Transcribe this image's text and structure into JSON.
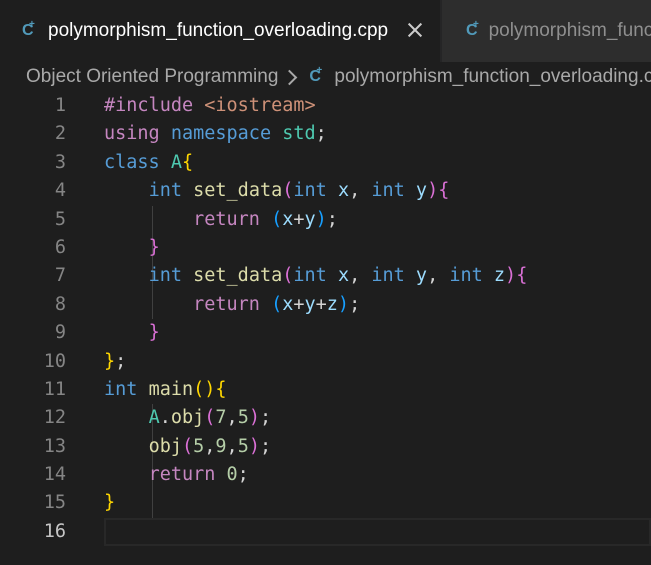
{
  "tabs": [
    {
      "label": "polymorphism_function_overloading.cpp",
      "icon": "cpp-file-icon",
      "active": true,
      "closable": true
    },
    {
      "label": "polymorphism_function_overloading.cpp",
      "icon": "cpp-file-icon",
      "active": false
    }
  ],
  "breadcrumb": {
    "folder": "Object Oriented Programming",
    "file": "polymorphism_function_overloading.cpp"
  },
  "editor": {
    "current_line": 16,
    "colors": {
      "background": "#1e1e1e",
      "keyword": "#c586c0",
      "type": "#569cd6",
      "function": "#dcdcaa",
      "variable": "#9cdcfe",
      "number": "#b5cea8",
      "string": "#ce9178",
      "class": "#4ec9b0"
    },
    "lines": [
      {
        "number": "1",
        "tokens": [
          {
            "t": "#include",
            "c": "kw"
          },
          {
            "t": " ",
            "c": "plain"
          },
          {
            "t": "<iostream>",
            "c": "str"
          }
        ]
      },
      {
        "number": "2",
        "tokens": [
          {
            "t": "using",
            "c": "kw"
          },
          {
            "t": " ",
            "c": "plain"
          },
          {
            "t": "namespace",
            "c": "type"
          },
          {
            "t": " ",
            "c": "plain"
          },
          {
            "t": "std",
            "c": "ns"
          },
          {
            "t": ";",
            "c": "plain"
          }
        ]
      },
      {
        "number": "3",
        "tokens": [
          {
            "t": "class",
            "c": "type"
          },
          {
            "t": " ",
            "c": "plain"
          },
          {
            "t": "A",
            "c": "cls"
          },
          {
            "t": "{",
            "c": "p1"
          }
        ]
      },
      {
        "number": "4",
        "tokens": [
          {
            "t": "    ",
            "c": "plain"
          },
          {
            "t": "int",
            "c": "type"
          },
          {
            "t": " ",
            "c": "plain"
          },
          {
            "t": "set_data",
            "c": "fn"
          },
          {
            "t": "(",
            "c": "p2"
          },
          {
            "t": "int",
            "c": "type"
          },
          {
            "t": " ",
            "c": "plain"
          },
          {
            "t": "x",
            "c": "var"
          },
          {
            "t": ", ",
            "c": "plain"
          },
          {
            "t": "int",
            "c": "type"
          },
          {
            "t": " ",
            "c": "plain"
          },
          {
            "t": "y",
            "c": "var"
          },
          {
            "t": ")",
            "c": "p2"
          },
          {
            "t": "{",
            "c": "p2"
          }
        ]
      },
      {
        "number": "5",
        "tokens": [
          {
            "t": "        ",
            "c": "plain"
          },
          {
            "t": "return",
            "c": "kw"
          },
          {
            "t": " ",
            "c": "plain"
          },
          {
            "t": "(",
            "c": "p3"
          },
          {
            "t": "x",
            "c": "var"
          },
          {
            "t": "+",
            "c": "plain"
          },
          {
            "t": "y",
            "c": "var"
          },
          {
            "t": ")",
            "c": "p3"
          },
          {
            "t": ";",
            "c": "plain"
          }
        ]
      },
      {
        "number": "6",
        "tokens": [
          {
            "t": "    ",
            "c": "plain"
          },
          {
            "t": "}",
            "c": "p2"
          }
        ]
      },
      {
        "number": "7",
        "tokens": [
          {
            "t": "    ",
            "c": "plain"
          },
          {
            "t": "int",
            "c": "type"
          },
          {
            "t": " ",
            "c": "plain"
          },
          {
            "t": "set_data",
            "c": "fn"
          },
          {
            "t": "(",
            "c": "p2"
          },
          {
            "t": "int",
            "c": "type"
          },
          {
            "t": " ",
            "c": "plain"
          },
          {
            "t": "x",
            "c": "var"
          },
          {
            "t": ", ",
            "c": "plain"
          },
          {
            "t": "int",
            "c": "type"
          },
          {
            "t": " ",
            "c": "plain"
          },
          {
            "t": "y",
            "c": "var"
          },
          {
            "t": ", ",
            "c": "plain"
          },
          {
            "t": "int",
            "c": "type"
          },
          {
            "t": " ",
            "c": "plain"
          },
          {
            "t": "z",
            "c": "var"
          },
          {
            "t": ")",
            "c": "p2"
          },
          {
            "t": "{",
            "c": "p2"
          }
        ]
      },
      {
        "number": "8",
        "tokens": [
          {
            "t": "        ",
            "c": "plain"
          },
          {
            "t": "return",
            "c": "kw"
          },
          {
            "t": " ",
            "c": "plain"
          },
          {
            "t": "(",
            "c": "p3"
          },
          {
            "t": "x",
            "c": "var"
          },
          {
            "t": "+",
            "c": "plain"
          },
          {
            "t": "y",
            "c": "var"
          },
          {
            "t": "+",
            "c": "plain"
          },
          {
            "t": "z",
            "c": "var"
          },
          {
            "t": ")",
            "c": "p3"
          },
          {
            "t": ";",
            "c": "plain"
          }
        ]
      },
      {
        "number": "9",
        "tokens": [
          {
            "t": "    ",
            "c": "plain"
          },
          {
            "t": "}",
            "c": "p2"
          }
        ]
      },
      {
        "number": "10",
        "tokens": [
          {
            "t": "}",
            "c": "p1"
          },
          {
            "t": ";",
            "c": "plain"
          }
        ]
      },
      {
        "number": "11",
        "tokens": [
          {
            "t": "int",
            "c": "type"
          },
          {
            "t": " ",
            "c": "plain"
          },
          {
            "t": "main",
            "c": "fn"
          },
          {
            "t": "()",
            "c": "p1"
          },
          {
            "t": "{",
            "c": "p1"
          }
        ]
      },
      {
        "number": "12",
        "tokens": [
          {
            "t": "    ",
            "c": "plain"
          },
          {
            "t": "A",
            "c": "cls"
          },
          {
            "t": ".",
            "c": "plain"
          },
          {
            "t": "obj",
            "c": "fn"
          },
          {
            "t": "(",
            "c": "p2"
          },
          {
            "t": "7",
            "c": "num"
          },
          {
            "t": ",",
            "c": "plain"
          },
          {
            "t": "5",
            "c": "num"
          },
          {
            "t": ")",
            "c": "p2"
          },
          {
            "t": ";",
            "c": "plain"
          }
        ]
      },
      {
        "number": "13",
        "tokens": [
          {
            "t": "    ",
            "c": "plain"
          },
          {
            "t": "obj",
            "c": "fn"
          },
          {
            "t": "(",
            "c": "p2"
          },
          {
            "t": "5",
            "c": "num"
          },
          {
            "t": ",",
            "c": "plain"
          },
          {
            "t": "9",
            "c": "num"
          },
          {
            "t": ",",
            "c": "plain"
          },
          {
            "t": "5",
            "c": "num"
          },
          {
            "t": ")",
            "c": "p2"
          },
          {
            "t": ";",
            "c": "plain"
          }
        ]
      },
      {
        "number": "14",
        "tokens": [
          {
            "t": "    ",
            "c": "plain"
          },
          {
            "t": "return",
            "c": "kw"
          },
          {
            "t": " ",
            "c": "plain"
          },
          {
            "t": "0",
            "c": "num"
          },
          {
            "t": ";",
            "c": "plain"
          }
        ]
      },
      {
        "number": "15",
        "tokens": [
          {
            "t": "}",
            "c": "p1"
          }
        ]
      },
      {
        "number": "16",
        "tokens": []
      }
    ]
  }
}
